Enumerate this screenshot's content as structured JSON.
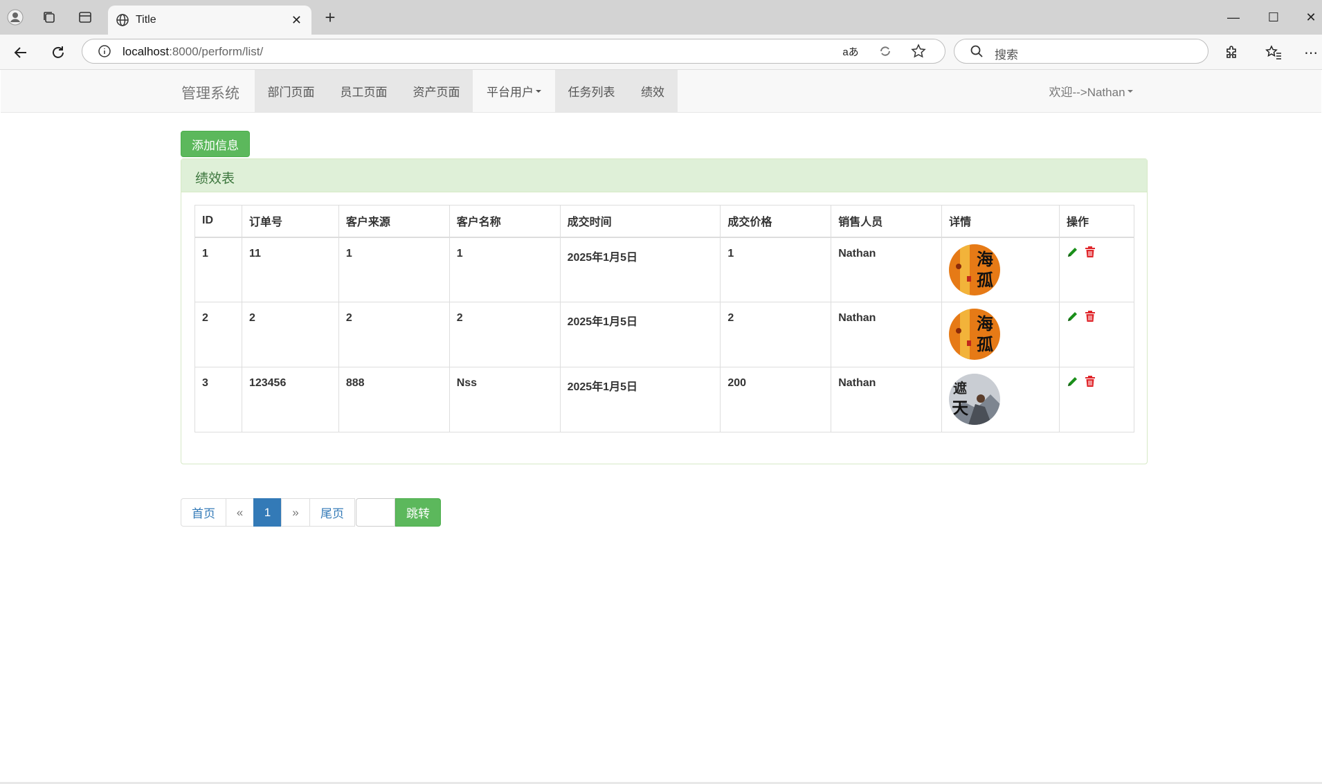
{
  "browser": {
    "tab_title": "Title",
    "url_host": "localhost",
    "url_rest": ":8000/perform/list/",
    "search_placeholder": "搜索",
    "translate_glyph": "aあ"
  },
  "navbar": {
    "brand": "管理系统",
    "items": [
      {
        "label": "部门页面"
      },
      {
        "label": "员工页面"
      },
      {
        "label": "资产页面"
      },
      {
        "label": "平台用户"
      },
      {
        "label": "任务列表"
      },
      {
        "label": "绩效"
      }
    ],
    "welcome": "欢迎-->Nathan"
  },
  "actions": {
    "add_label": "添加信息"
  },
  "panel": {
    "title": "绩效表"
  },
  "table": {
    "headers": [
      "ID",
      "订单号",
      "客户来源",
      "客户名称",
      "成交时间",
      "成交价格",
      "销售人员",
      "详情",
      "操作"
    ],
    "rows": [
      {
        "id": "1",
        "order": "11",
        "source": "1",
        "customer": "1",
        "date": "2025年1月5日",
        "price": "1",
        "sales": "Nathan",
        "avatar": "orange-calligraphy",
        "avatar_text": "海孤"
      },
      {
        "id": "2",
        "order": "2",
        "source": "2",
        "customer": "2",
        "date": "2025年1月5日",
        "price": "2",
        "sales": "Nathan",
        "avatar": "orange-calligraphy",
        "avatar_text": "海孤"
      },
      {
        "id": "3",
        "order": "123456",
        "source": "888",
        "customer": "Nss",
        "date": "2025年1月5日",
        "price": "200",
        "sales": "Nathan",
        "avatar": "grey-ink-figure",
        "avatar_text": "遮天"
      }
    ]
  },
  "pagination": {
    "first": "首页",
    "prev": "«",
    "current": "1",
    "next": "»",
    "last": "尾页",
    "go": "跳转"
  },
  "colors": {
    "success": "#5cb85c",
    "primary": "#337ab7",
    "edit_icon": "#1a8f1a",
    "delete_icon": "#e0262b",
    "panel_head": "#dff0d8"
  }
}
